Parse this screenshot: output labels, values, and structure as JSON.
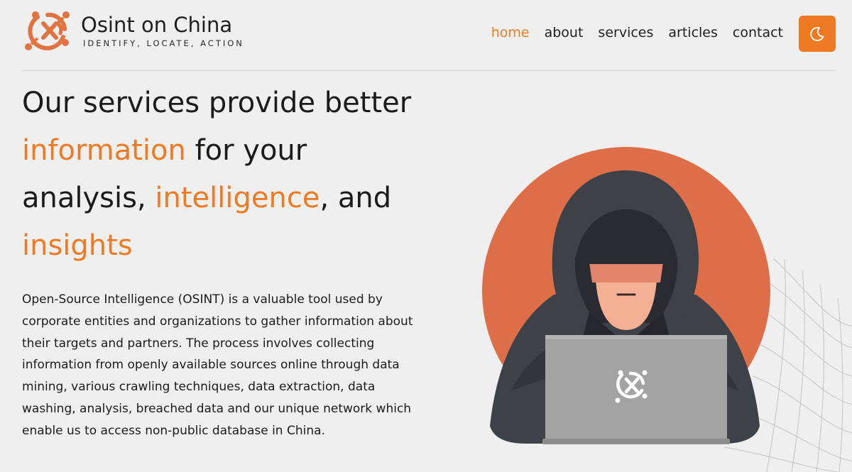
{
  "brand": {
    "name": "Osint on China",
    "tagline": "IDENTIFY, LOCATE, ACTION"
  },
  "nav": {
    "items": [
      {
        "label": "home",
        "active": true
      },
      {
        "label": "about",
        "active": false
      },
      {
        "label": "services",
        "active": false
      },
      {
        "label": "articles",
        "active": false
      },
      {
        "label": "contact",
        "active": false
      }
    ],
    "theme_toggle_icon": "moon-icon"
  },
  "hero": {
    "title_parts": {
      "p1": "Our services provide better",
      "p2": "information",
      "p3": " for your",
      "p4": "analysis, ",
      "p5": "intelligence",
      "p6": ", and",
      "p7": "insights"
    },
    "description": "Open-Source Intelligence (OSINT) is a valuable tool used by corporate entities and organizations to gather information about their targets and partners. The process involves collecting information from openly available sources online through data mining, various crawling techniques, data extraction, data washing, analysis, breached data and our unique network which enable us to access non-public database in China."
  },
  "colors": {
    "accent": "#ef7a24",
    "circle": "#dd6e48",
    "background": "#efefef",
    "hood": "#3f4148",
    "laptop": "#a3a3a3"
  },
  "illustration": {
    "subject": "hooded-hacker-with-laptop",
    "laptop_logo_icon": "crosshair-logo-icon"
  }
}
